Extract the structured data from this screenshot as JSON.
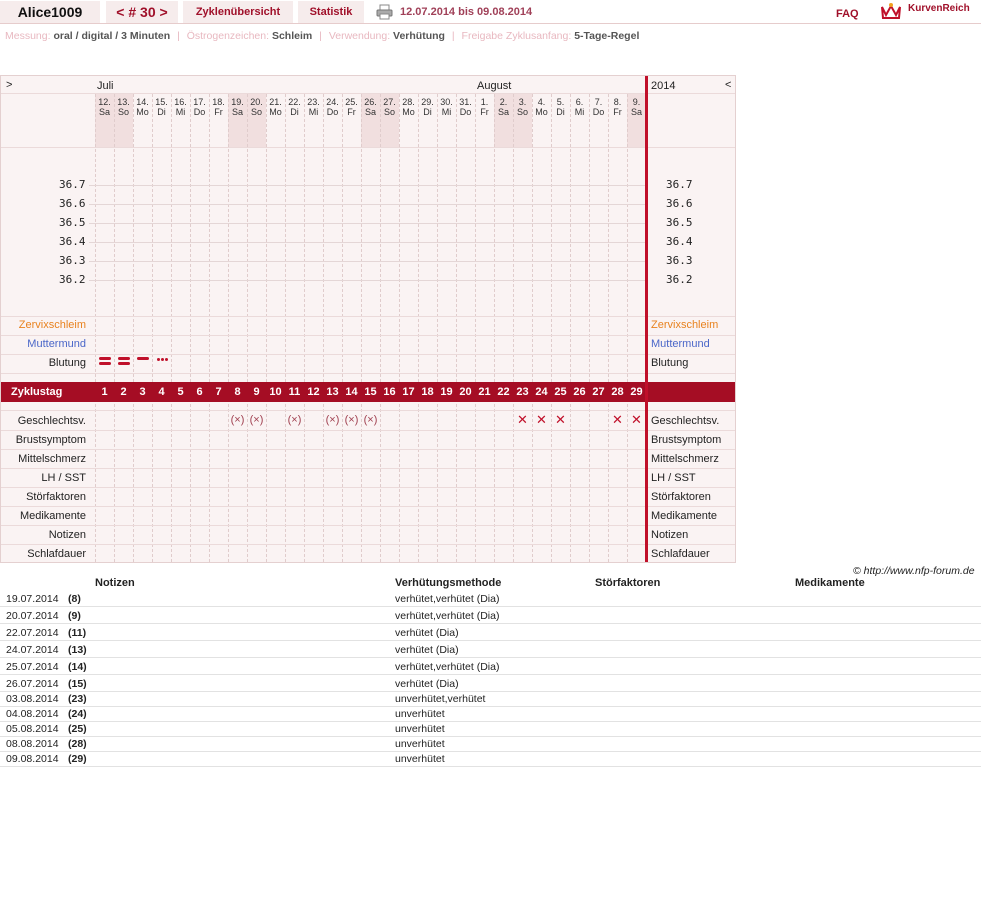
{
  "header": {
    "username": "Alice1009",
    "cycle_nav": "< # 30 >",
    "overview_tab": "Zyklenübersicht",
    "stats_tab": "Statistik",
    "print_icon": "printer-icon",
    "date_range": "12.07.2014 bis 09.08.2014",
    "faq": "FAQ",
    "logo_text": "KurvenReich",
    "logo_icon": "crown-icon"
  },
  "info": {
    "messung_label": "Messung:",
    "messung_value": "oral / digital / 3 Minuten",
    "oestrogen_label": "Östrogenzeichen:",
    "oestrogen_value": "Schleim",
    "verwendung_label": "Verwendung:",
    "verwendung_value": "Verhütung",
    "freigabe_label": "Freigabe Zyklusanfang:",
    "freigabe_value": "5-Tage-Regel"
  },
  "chart": {
    "nav_prev": ">",
    "nav_next": "<",
    "month1": "Juli",
    "month2": "August",
    "year": "2014",
    "colors": {
      "bar": "#a50d24",
      "accent": "#c0102a",
      "zervix": "#e8821e",
      "muttermund": "#4a66c8"
    },
    "days": [
      {
        "d": "12.",
        "w": "Sa",
        "we": true
      },
      {
        "d": "13.",
        "w": "So",
        "we": true
      },
      {
        "d": "14.",
        "w": "Mo"
      },
      {
        "d": "15.",
        "w": "Di"
      },
      {
        "d": "16.",
        "w": "Mi"
      },
      {
        "d": "17.",
        "w": "Do"
      },
      {
        "d": "18.",
        "w": "Fr"
      },
      {
        "d": "19.",
        "w": "Sa",
        "we": true
      },
      {
        "d": "20.",
        "w": "So",
        "we": true
      },
      {
        "d": "21.",
        "w": "Mo"
      },
      {
        "d": "22.",
        "w": "Di"
      },
      {
        "d": "23.",
        "w": "Mi"
      },
      {
        "d": "24.",
        "w": "Do"
      },
      {
        "d": "25.",
        "w": "Fr"
      },
      {
        "d": "26.",
        "w": "Sa",
        "we": true
      },
      {
        "d": "27.",
        "w": "So",
        "we": true
      },
      {
        "d": "28.",
        "w": "Mo"
      },
      {
        "d": "29.",
        "w": "Di"
      },
      {
        "d": "30.",
        "w": "Mi"
      },
      {
        "d": "31.",
        "w": "Do"
      },
      {
        "d": "1.",
        "w": "Fr"
      },
      {
        "d": "2.",
        "w": "Sa",
        "we": true
      },
      {
        "d": "3.",
        "w": "So",
        "we": true
      },
      {
        "d": "4.",
        "w": "Mo"
      },
      {
        "d": "5.",
        "w": "Di"
      },
      {
        "d": "6.",
        "w": "Mi"
      },
      {
        "d": "7.",
        "w": "Do"
      },
      {
        "d": "8.",
        "w": "Fr"
      },
      {
        "d": "9.",
        "w": "Sa",
        "we": true
      }
    ],
    "temp_scale": [
      "36.7",
      "36.6",
      "36.5",
      "36.4",
      "36.3",
      "36.2"
    ],
    "rows_top": [
      "Zervixschleim",
      "Muttermund",
      "Blutung"
    ],
    "zyklustag_label": "Zyklustag",
    "cycle_days": [
      "1",
      "2",
      "3",
      "4",
      "5",
      "6",
      "7",
      "8",
      "9",
      "10",
      "11",
      "12",
      "13",
      "14",
      "15",
      "16",
      "17",
      "18",
      "19",
      "20",
      "21",
      "22",
      "23",
      "24",
      "25",
      "26",
      "27",
      "28",
      "29"
    ],
    "bleeding": [
      {
        "day": 1,
        "type": "heavy"
      },
      {
        "day": 2,
        "type": "heavy"
      },
      {
        "day": 3,
        "type": "medium"
      },
      {
        "day": 4,
        "type": "spotting"
      }
    ],
    "rows_bottom": [
      "Geschlechtsv.",
      "Brustsymptom",
      "Mittelschmerz",
      "LH / SST",
      "Störfaktoren",
      "Medikamente",
      "Notizen",
      "Schlafdauer"
    ],
    "intercourse": [
      {
        "day": 8,
        "mark": "(×)"
      },
      {
        "day": 9,
        "mark": "(×)"
      },
      {
        "day": 11,
        "mark": "(×)"
      },
      {
        "day": 13,
        "mark": "(×)"
      },
      {
        "day": 14,
        "mark": "(×)"
      },
      {
        "day": 15,
        "mark": "(×)"
      },
      {
        "day": 23,
        "mark": "✕"
      },
      {
        "day": 24,
        "mark": "✕"
      },
      {
        "day": 25,
        "mark": "✕"
      },
      {
        "day": 28,
        "mark": "✕"
      },
      {
        "day": 29,
        "mark": "✕"
      }
    ]
  },
  "copyright": "© http://www.nfp-forum.de",
  "notes": {
    "headers": {
      "notizen": "Notizen",
      "methode": "Verhütungsmethode",
      "stoer": "Störfaktoren",
      "medi": "Medikamente"
    },
    "rows": [
      {
        "date": "19.07.2014",
        "cd": "(8)",
        "method": "verhütet,verhütet (Dia)"
      },
      {
        "date": "20.07.2014",
        "cd": "(9)",
        "method": "verhütet,verhütet (Dia)"
      },
      {
        "date": "22.07.2014",
        "cd": "(11)",
        "method": "verhütet (Dia)"
      },
      {
        "date": "24.07.2014",
        "cd": "(13)",
        "method": "verhütet (Dia)"
      },
      {
        "date": "25.07.2014",
        "cd": "(14)",
        "method": "verhütet,verhütet (Dia)"
      },
      {
        "date": "26.07.2014",
        "cd": "(15)",
        "method": "verhütet (Dia)"
      },
      {
        "date": "03.08.2014",
        "cd": "(23)",
        "method": "unverhütet,verhütet"
      },
      {
        "date": "04.08.2014",
        "cd": "(24)",
        "method": "unverhütet"
      },
      {
        "date": "05.08.2014",
        "cd": "(25)",
        "method": "unverhütet"
      },
      {
        "date": "08.08.2014",
        "cd": "(28)",
        "method": "unverhütet"
      },
      {
        "date": "09.08.2014",
        "cd": "(29)",
        "method": "unverhütet"
      }
    ]
  }
}
